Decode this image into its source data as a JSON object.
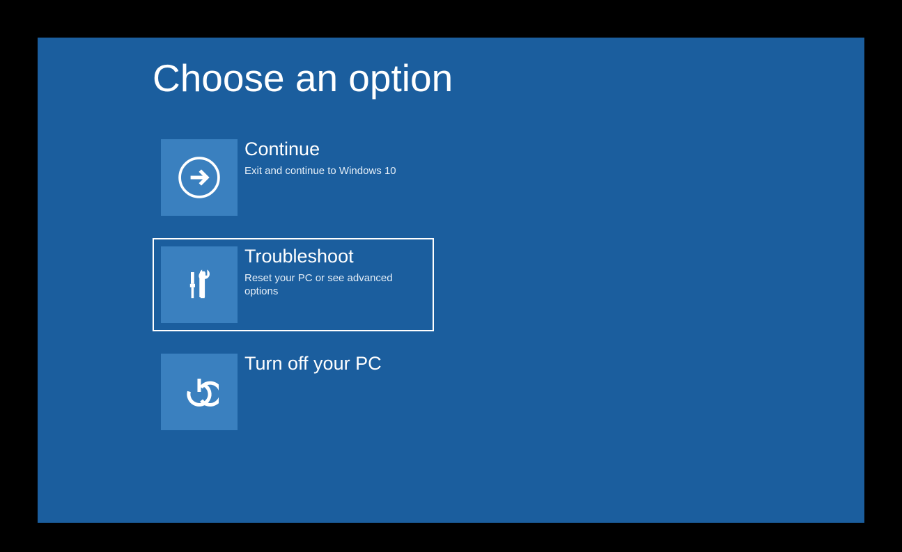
{
  "title": "Choose an option",
  "options": [
    {
      "icon": "arrow-right-icon",
      "title": "Continue",
      "subtitle": "Exit and continue to Windows 10",
      "selected": false
    },
    {
      "icon": "tools-icon",
      "title": "Troubleshoot",
      "subtitle": "Reset your PC or see advanced options",
      "selected": true
    },
    {
      "icon": "power-icon",
      "title": "Turn off your PC",
      "subtitle": "",
      "selected": false
    }
  ],
  "colors": {
    "background": "#1b5e9e",
    "tile": "#3a80bf",
    "frame": "#000000",
    "text": "#ffffff"
  }
}
